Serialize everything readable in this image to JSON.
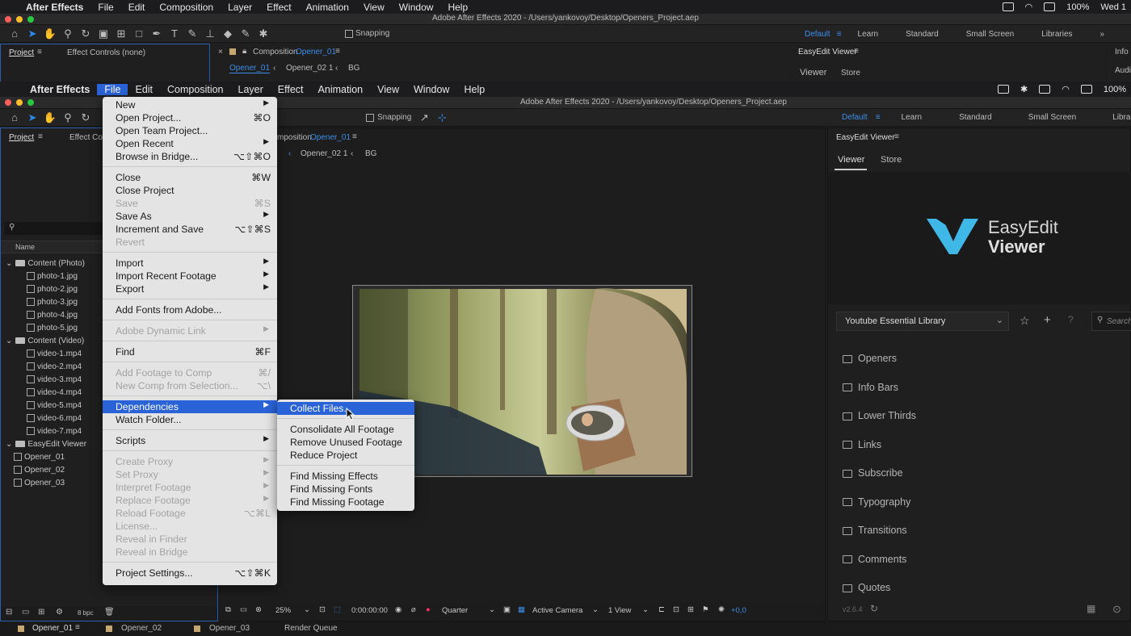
{
  "menubar_back": {
    "apple": "",
    "app": "After Effects",
    "items": [
      "File",
      "Edit",
      "Composition",
      "Layer",
      "Effect",
      "Animation",
      "View",
      "Window",
      "Help"
    ],
    "battery": "100%",
    "clock": "Wed 1"
  },
  "menubar_front": {
    "app": "After Effects",
    "items": [
      "File",
      "Edit",
      "Composition",
      "Layer",
      "Effect",
      "Animation",
      "View",
      "Window",
      "Help"
    ],
    "open_item": "File",
    "battery": "100%"
  },
  "window": {
    "title": "Adobe After Effects 2020 - /Users/yankovoy/Desktop/Openers_Project.aep"
  },
  "toolbar": {
    "snapping": "Snapping",
    "workspaces": [
      "Default",
      "Learn",
      "Standard",
      "Small Screen",
      "Libraries"
    ],
    "active_workspace": "Default"
  },
  "back_panels": {
    "project_tab": "Project",
    "effect_controls_tab": "Effect Controls (none)",
    "composition_tab_prefix": "Composition",
    "composition_name": "Opener_01",
    "breadcrumb": [
      "Opener_01",
      "Opener_02 1",
      "BG"
    ],
    "easyedit_title": "EasyEdit Viewer",
    "viewer_tab": "Viewer",
    "store_tab": "Store",
    "info_tab": "Info",
    "audio_tab": "Audio"
  },
  "project_panel": {
    "tab": "Project",
    "effect_controls_tab": "Effect Contro",
    "search_icon": "search-icon",
    "name_header": "Name",
    "tree": [
      {
        "type": "folder",
        "label": "Content (Photo)",
        "depth": 0
      },
      {
        "type": "file",
        "label": "photo-1.jpg",
        "depth": 1
      },
      {
        "type": "file",
        "label": "photo-2.jpg",
        "depth": 1
      },
      {
        "type": "file",
        "label": "photo-3.jpg",
        "depth": 1
      },
      {
        "type": "file",
        "label": "photo-4.jpg",
        "depth": 1
      },
      {
        "type": "file",
        "label": "photo-5.jpg",
        "depth": 1
      },
      {
        "type": "folder",
        "label": "Content (Video)",
        "depth": 0
      },
      {
        "type": "file",
        "label": "video-1.mp4",
        "depth": 1
      },
      {
        "type": "file",
        "label": "video-2.mp4",
        "depth": 1
      },
      {
        "type": "file",
        "label": "video-3.mp4",
        "depth": 1
      },
      {
        "type": "file",
        "label": "video-4.mp4",
        "depth": 1
      },
      {
        "type": "file",
        "label": "video-5.mp4",
        "depth": 1
      },
      {
        "type": "file",
        "label": "video-6.mp4",
        "depth": 1
      },
      {
        "type": "file",
        "label": "video-7.mp4",
        "depth": 1
      },
      {
        "type": "folder",
        "label": "EasyEdit Viewer",
        "depth": 0
      },
      {
        "type": "comp",
        "label": "Opener_01",
        "depth": 0
      },
      {
        "type": "comp",
        "label": "Opener_02",
        "depth": 0
      },
      {
        "type": "comp",
        "label": "Opener_03",
        "depth": 0
      }
    ],
    "bpc": "8 bpc"
  },
  "composition_panel": {
    "tab_prefix": "mposition",
    "comp_name": "Opener_01",
    "breadcrumb": [
      "Opener_02 1",
      "BG"
    ],
    "zoom": "25%",
    "timecode": "0:00:00:00",
    "resolution": "Quarter",
    "camera": "Active Camera",
    "views": "1 View",
    "exposure": "+0,0"
  },
  "file_menu": {
    "items": [
      {
        "label": "New",
        "shortcut": "",
        "arrow": true,
        "disabled": false
      },
      {
        "label": "Open Project...",
        "shortcut": "⌘O",
        "arrow": false,
        "disabled": false
      },
      {
        "label": "Open Team Project...",
        "shortcut": "",
        "arrow": false,
        "disabled": false
      },
      {
        "label": "Open Recent",
        "shortcut": "",
        "arrow": true,
        "disabled": false
      },
      {
        "label": "Browse in Bridge...",
        "shortcut": "⌥⇧⌘O",
        "arrow": false,
        "disabled": false
      },
      {
        "sep": true
      },
      {
        "label": "Close",
        "shortcut": "⌘W",
        "arrow": false,
        "disabled": false
      },
      {
        "label": "Close Project",
        "shortcut": "",
        "arrow": false,
        "disabled": false
      },
      {
        "label": "Save",
        "shortcut": "⌘S",
        "arrow": false,
        "disabled": true
      },
      {
        "label": "Save As",
        "shortcut": "",
        "arrow": true,
        "disabled": false
      },
      {
        "label": "Increment and Save",
        "shortcut": "⌥⇧⌘S",
        "arrow": false,
        "disabled": false
      },
      {
        "label": "Revert",
        "shortcut": "",
        "arrow": false,
        "disabled": true
      },
      {
        "sep": true
      },
      {
        "label": "Import",
        "shortcut": "",
        "arrow": true,
        "disabled": false
      },
      {
        "label": "Import Recent Footage",
        "shortcut": "",
        "arrow": true,
        "disabled": false
      },
      {
        "label": "Export",
        "shortcut": "",
        "arrow": true,
        "disabled": false
      },
      {
        "sep": true
      },
      {
        "label": "Add Fonts from Adobe...",
        "shortcut": "",
        "arrow": false,
        "disabled": false
      },
      {
        "sep": true
      },
      {
        "label": "Adobe Dynamic Link",
        "shortcut": "",
        "arrow": true,
        "disabled": true
      },
      {
        "sep": true
      },
      {
        "label": "Find",
        "shortcut": "⌘F",
        "arrow": false,
        "disabled": false
      },
      {
        "sep": true
      },
      {
        "label": "Add Footage to Comp",
        "shortcut": "⌘/",
        "arrow": false,
        "disabled": true
      },
      {
        "label": "New Comp from Selection...",
        "shortcut": "⌥\\",
        "arrow": false,
        "disabled": true
      },
      {
        "sep": true
      },
      {
        "label": "Dependencies",
        "shortcut": "",
        "arrow": true,
        "disabled": false,
        "highlighted": true
      },
      {
        "label": "Watch Folder...",
        "shortcut": "",
        "arrow": false,
        "disabled": false
      },
      {
        "sep": true
      },
      {
        "label": "Scripts",
        "shortcut": "",
        "arrow": true,
        "disabled": false
      },
      {
        "sep": true
      },
      {
        "label": "Create Proxy",
        "shortcut": "",
        "arrow": true,
        "disabled": true
      },
      {
        "label": "Set Proxy",
        "shortcut": "",
        "arrow": true,
        "disabled": true
      },
      {
        "label": "Interpret Footage",
        "shortcut": "",
        "arrow": true,
        "disabled": true
      },
      {
        "label": "Replace Footage",
        "shortcut": "",
        "arrow": true,
        "disabled": true
      },
      {
        "label": "Reload Footage",
        "shortcut": "⌥⌘L",
        "arrow": false,
        "disabled": true
      },
      {
        "label": "License...",
        "shortcut": "",
        "arrow": false,
        "disabled": true
      },
      {
        "label": "Reveal in Finder",
        "shortcut": "",
        "arrow": false,
        "disabled": true
      },
      {
        "label": "Reveal in Bridge",
        "shortcut": "",
        "arrow": false,
        "disabled": true
      },
      {
        "sep": true
      },
      {
        "label": "Project Settings...",
        "shortcut": "⌥⇧⌘K",
        "arrow": false,
        "disabled": false
      }
    ]
  },
  "dependencies_submenu": {
    "items": [
      {
        "label": "Collect Files...",
        "highlighted": true
      },
      {
        "sep": true
      },
      {
        "label": "Consolidate All Footage"
      },
      {
        "label": "Remove Unused Footage"
      },
      {
        "label": "Reduce Project"
      },
      {
        "sep": true
      },
      {
        "label": "Find Missing Effects"
      },
      {
        "label": "Find Missing Fonts"
      },
      {
        "label": "Find Missing Footage"
      }
    ]
  },
  "easyedit": {
    "panel_title": "EasyEdit Viewer",
    "tabs": [
      "Viewer",
      "Store"
    ],
    "logo_line1": "EasyEdit",
    "logo_line2": "Viewer",
    "library": "Youtube Essential Library",
    "search_placeholder": "Search",
    "folders": [
      "Openers",
      "Info Bars",
      "Lower Thirds",
      "Links",
      "Subscribe",
      "Typography",
      "Transitions",
      "Comments",
      "Quotes"
    ],
    "version": "v2.6.4",
    "accent": "#3fb8e8"
  },
  "bottom_tabs": [
    "Opener_01",
    "Opener_02",
    "Opener_03",
    "Render Queue"
  ]
}
